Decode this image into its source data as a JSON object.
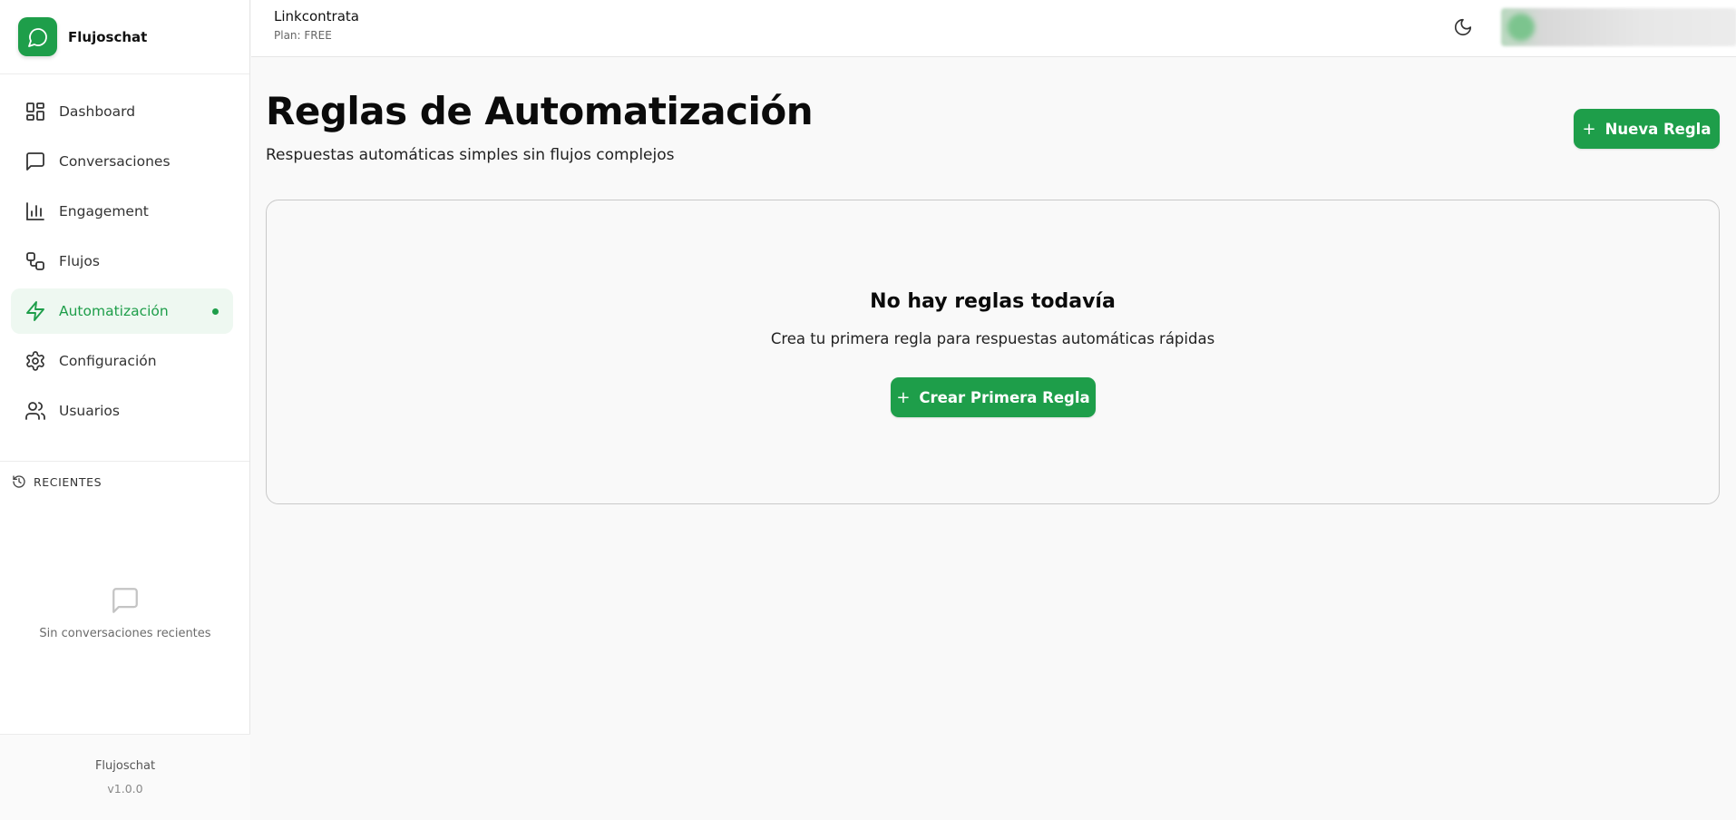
{
  "app": {
    "name": "Flujoschat",
    "version": "v1.0.0"
  },
  "colors": {
    "accent": "#1e9e4a",
    "active_bg": "#eef8f1"
  },
  "sidebar": {
    "items": [
      {
        "label": "Dashboard",
        "icon": "dashboard-icon",
        "active": false
      },
      {
        "label": "Conversaciones",
        "icon": "message-icon",
        "active": false
      },
      {
        "label": "Engagement",
        "icon": "bar-chart-icon",
        "active": false
      },
      {
        "label": "Flujos",
        "icon": "workflow-icon",
        "active": false
      },
      {
        "label": "Automatización",
        "icon": "lightning-icon",
        "active": true
      },
      {
        "label": "Configuración",
        "icon": "gear-icon",
        "active": false
      },
      {
        "label": "Usuarios",
        "icon": "users-icon",
        "active": false
      }
    ],
    "recent": {
      "header": "RECIENTES",
      "empty_text": "Sin conversaciones recientes"
    },
    "footer": {
      "name": "Flujoschat",
      "version": "v1.0.0"
    }
  },
  "topbar": {
    "org_name": "Linkcontrata",
    "plan": "Plan: FREE"
  },
  "main": {
    "title": "Reglas de Automatización",
    "subtitle": "Respuestas automáticas simples sin flujos complejos",
    "new_button": "Nueva Regla",
    "empty": {
      "title": "No hay reglas todavía",
      "text": "Crea tu primera regla para respuestas automáticas rápidas",
      "button": "Crear Primera Regla"
    }
  }
}
